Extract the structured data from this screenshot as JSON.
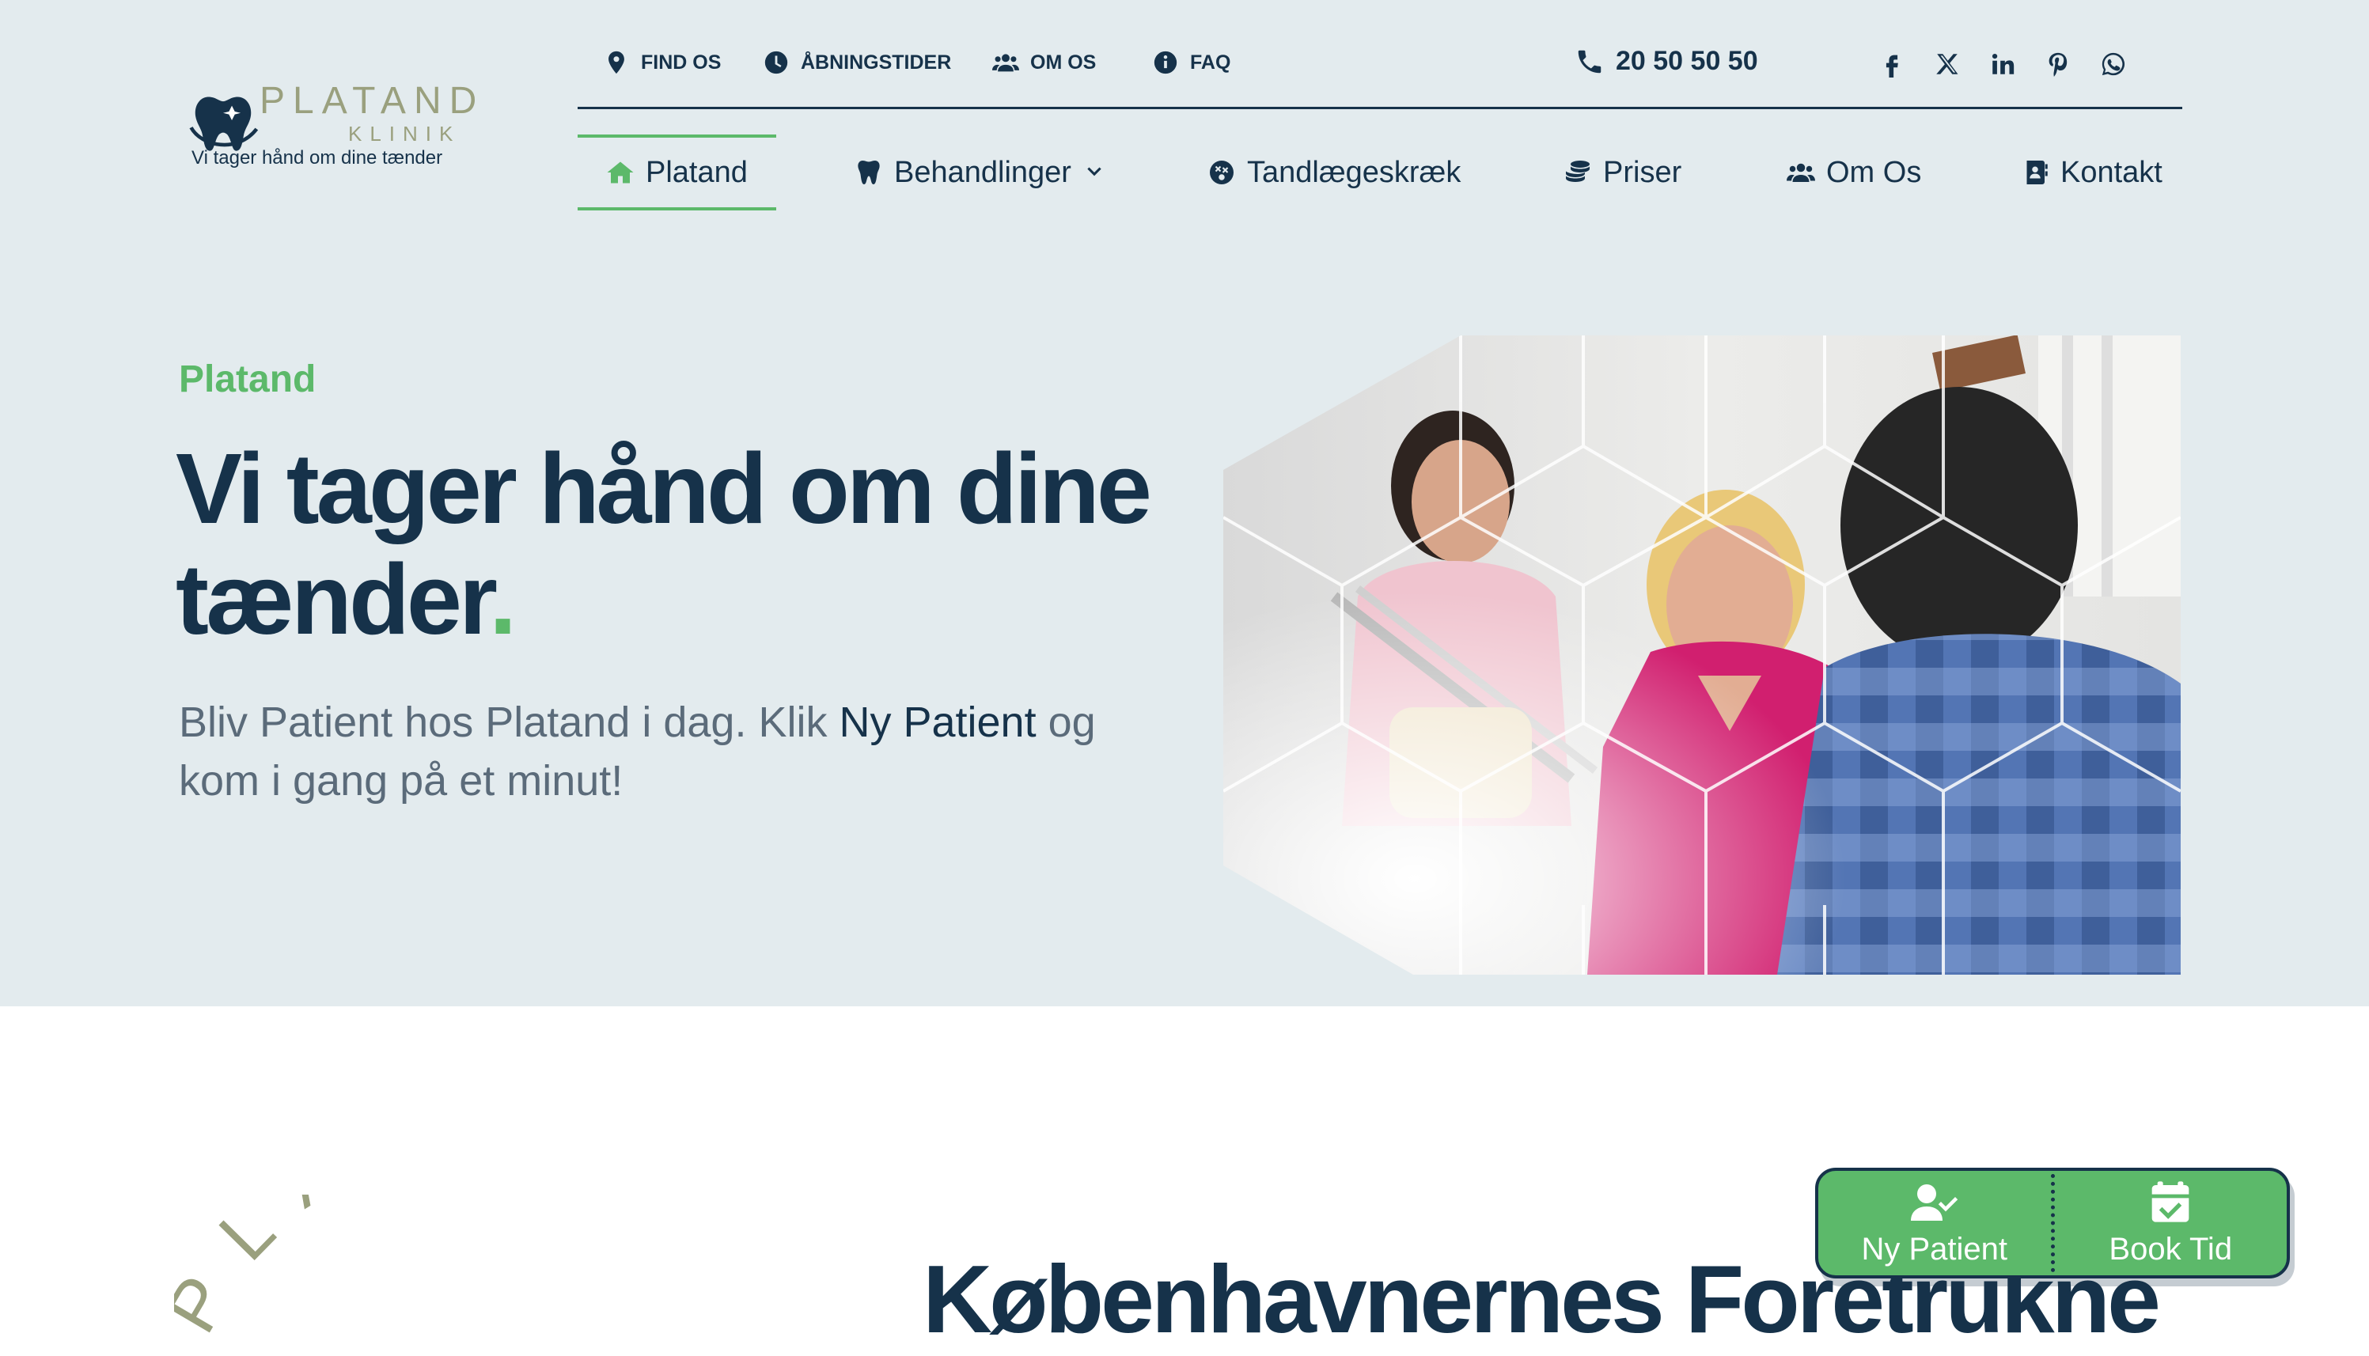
{
  "logo": {
    "brand": "PLATAND",
    "sub": "KLINIK",
    "tagline": "Vi tager hånd om dine tænder"
  },
  "utility": {
    "items": [
      {
        "label": "FIND OS",
        "icon": "map-pin-icon"
      },
      {
        "label": "ÅBNINGSTIDER",
        "icon": "clock-icon"
      },
      {
        "label": "OM OS",
        "icon": "users-icon"
      },
      {
        "label": "FAQ",
        "icon": "info-icon"
      }
    ],
    "phone": "20 50 50 50",
    "social": [
      "facebook-icon",
      "x-icon",
      "linkedin-icon",
      "pinterest-icon",
      "whatsapp-icon"
    ]
  },
  "nav": {
    "items": [
      {
        "label": "Platand",
        "icon": "home-icon",
        "active": true
      },
      {
        "label": "Behandlinger",
        "icon": "tooth-icon",
        "has_dropdown": true
      },
      {
        "label": "Tandlægeskræk",
        "icon": "dizzy-face-icon"
      },
      {
        "label": "Priser",
        "icon": "coins-icon"
      },
      {
        "label": "Om Os",
        "icon": "users-icon"
      },
      {
        "label": "Kontakt",
        "icon": "contact-book-icon"
      }
    ]
  },
  "hero": {
    "eyebrow": "Platand",
    "headline": "Vi tager hånd om dine tænder",
    "headline_dot": ".",
    "lead_before": "Bliv Patient hos Platand i dag. Klik ",
    "lead_strong": "Ny Patient",
    "lead_after": " og kom i gang på et minut!"
  },
  "section": {
    "arc_text": "PLATAND",
    "title": "Københavnernes Foretrukne"
  },
  "cta": {
    "new_patient": "Ny Patient",
    "book": "Book Tid"
  },
  "colors": {
    "navy": "#16324a",
    "green": "#5cb96a",
    "band": "#e3ebee",
    "olive": "#9aa07e"
  }
}
